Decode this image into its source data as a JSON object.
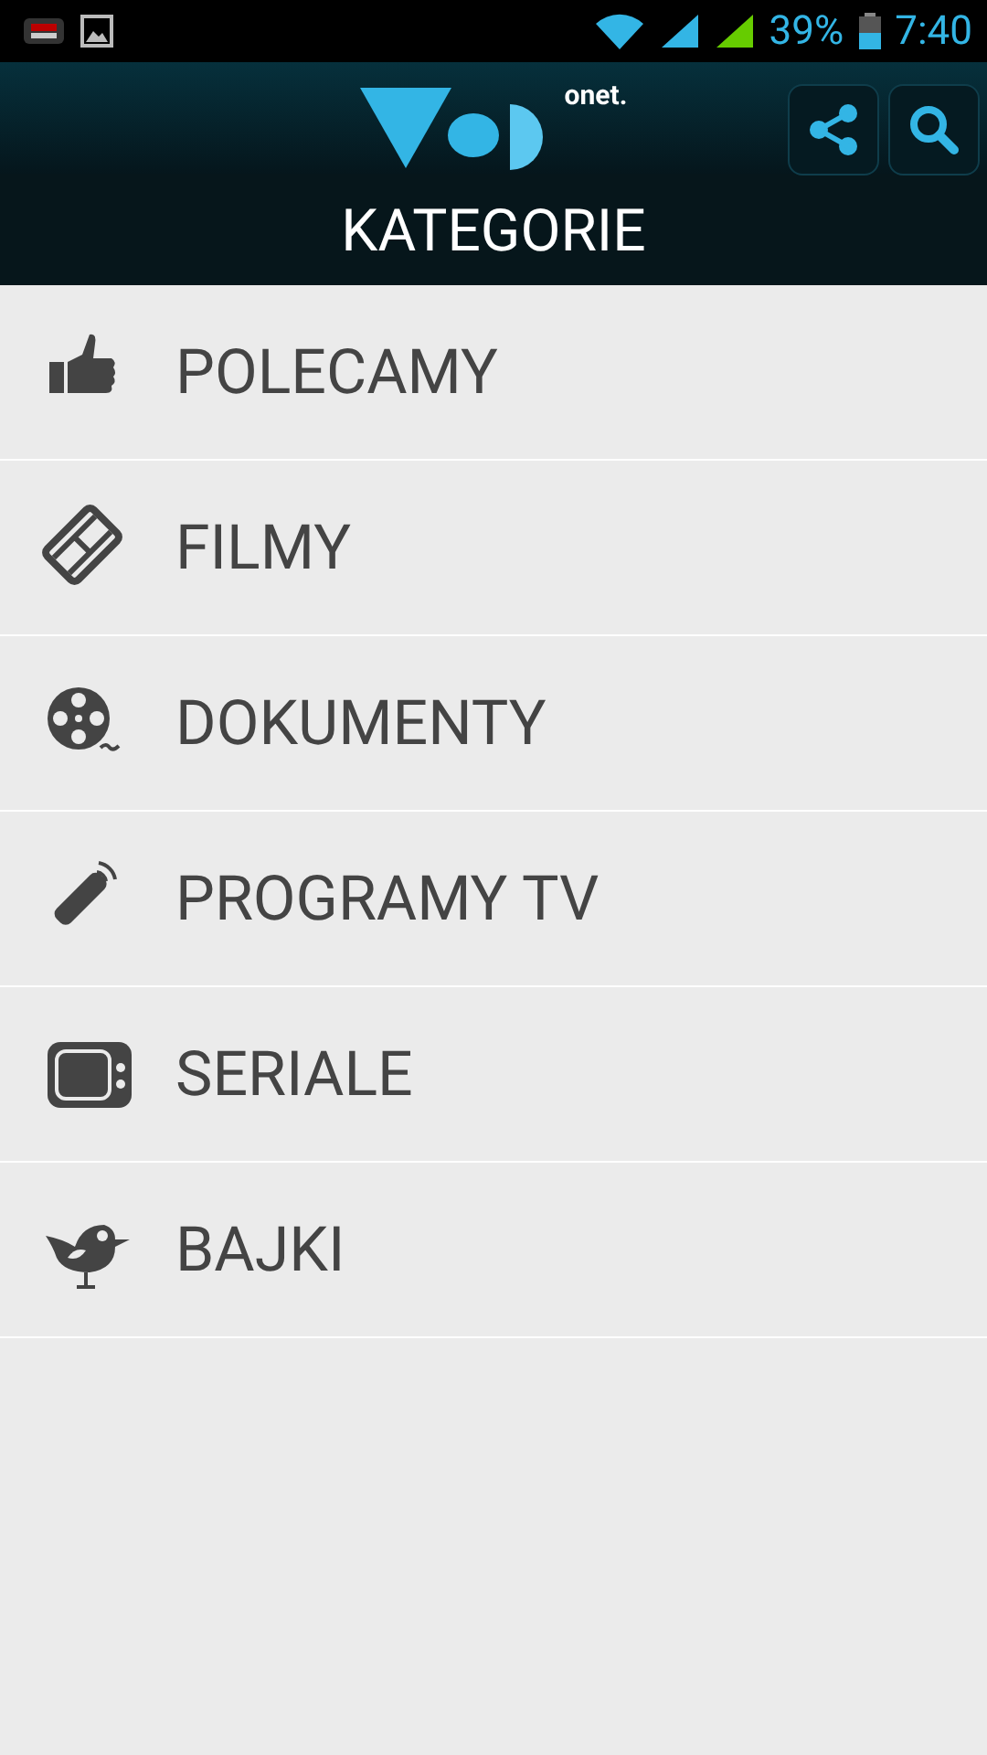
{
  "status_bar": {
    "battery": "39%",
    "time": "7:40"
  },
  "header": {
    "logo_text": "onet.",
    "title": "KATEGORIE"
  },
  "categories": [
    {
      "kind": "thumb",
      "label": "POLECAMY"
    },
    {
      "kind": "film",
      "label": "FILMY"
    },
    {
      "kind": "reel",
      "label": "DOKUMENTY"
    },
    {
      "kind": "remote",
      "label": "PROGRAMY TV"
    },
    {
      "kind": "tv",
      "label": "SERIALE"
    },
    {
      "kind": "bird",
      "label": "BAJKI"
    }
  ]
}
